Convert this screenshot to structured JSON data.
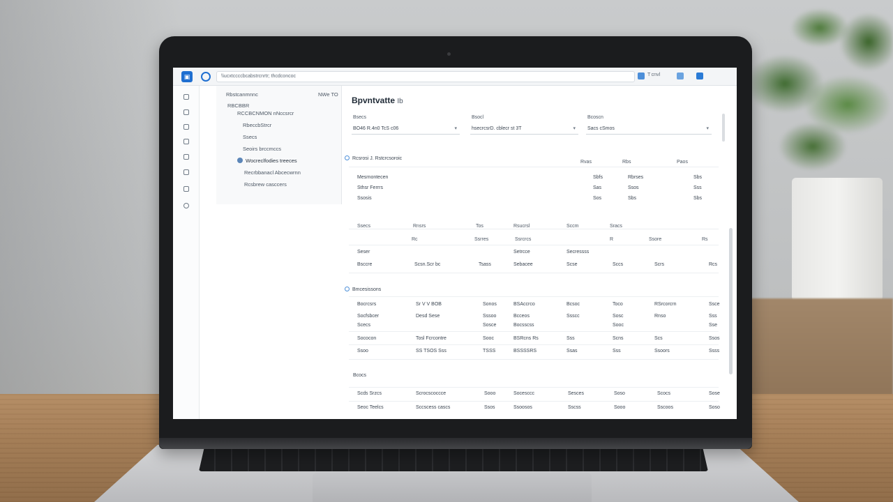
{
  "screen": {
    "address_text": "\\\\ucxtccccbcabstrcnrtr; thcdconcoc",
    "titlebar_right": [
      "T cnvl"
    ],
    "tree": {
      "header_left": "Rbstcanmnnc",
      "header_right": "NWe TO",
      "items": [
        {
          "label": "RBCBBR",
          "indent": 0
        },
        {
          "label": "RCCBCNMON nNccsrcr",
          "indent": 0
        },
        {
          "label": "RbeccbStrcr",
          "indent": 1
        },
        {
          "label": "Ssecs",
          "indent": 1
        },
        {
          "label": "Seoirs brccmccs",
          "indent": 1
        },
        {
          "label": "Wocreclfodies treeces",
          "indent": 1,
          "selected": true
        },
        {
          "label": "Recrbbanacl Abcecwrnn",
          "indent": 1
        },
        {
          "label": "Rcsbrew casccers",
          "indent": 1
        }
      ]
    },
    "content": {
      "page_title": "Bpvntvatte",
      "page_title_suffix": "Ib",
      "filters": [
        {
          "label": "Bsecs",
          "value": "BO46 R.4n0 TcS c06"
        },
        {
          "label": "Bsocl",
          "value": "hsecrcsrD. cblecr st 3T"
        },
        {
          "label": "Bcoscn",
          "value": "Sacs cSmos"
        }
      ],
      "table1": {
        "title": "Rcsrosi J. Rstcrcsoroic",
        "headers": [
          "",
          "Rvas",
          "Rbs",
          "Paos"
        ],
        "rows": [
          [
            "Mesrnontecen",
            "Sbfs",
            "Rbrses",
            "Sbs"
          ],
          [
            "Sthsr Ferrrs",
            "Sas",
            "Ssos",
            "Sss"
          ],
          [
            "Ssosis",
            "Sos",
            "Sbs",
            "Sbs"
          ]
        ]
      },
      "table2": {
        "headers": [
          "Ssecs",
          "Rnsrs",
          "Tos",
          "Rsucrsl",
          "Sccm",
          "Sracs"
        ],
        "subheaders": [
          "",
          "Rc",
          "Ssrres",
          "Ssrcrcs",
          "R  ",
          "Ssore",
          "Rs"
        ],
        "rows": [
          [
            "Seser",
            "",
            "",
            "Setrcce",
            "Secressss",
            "",
            "",
            ""
          ],
          [
            "Bsccre",
            "Scsn.Scr bc",
            "Tsass",
            "Sebacee",
            "Scse",
            "Sccs",
            "Scrs",
            "Rcs"
          ]
        ]
      },
      "table3": {
        "title": "Bmcesissons",
        "rows": [
          [
            "Bocrcsrs",
            "Sr V V BOB",
            "Sonos",
            "BSAccrco",
            "Bcsoc",
            "Toco",
            "RSrcorcrn",
            "Ssce"
          ],
          [
            "Socfsbcer",
            "Desd Sese",
            "Sssoo",
            "Bcceos",
            "Ssscc",
            "Sosc",
            "Rnso",
            "Sss"
          ],
          [
            "Scecs",
            "",
            "Sosce",
            "Bocsscss",
            "",
            "Sooc",
            "",
            "Sse"
          ],
          [
            "Sococon",
            "Tosl Fcrcontre",
            "Sooc",
            "BSRcns Rs",
            "Sss",
            "Scns",
            "Scs",
            "Ssos"
          ],
          [
            "Ssoo",
            "SS TSOS Sss",
            "TSSS",
            "BSSSSRS",
            "Ssas",
            "Sss",
            "Ssoors",
            "Ssss"
          ]
        ]
      },
      "table4": {
        "title": "Bcocs",
        "rows": [
          [
            "Scds Srzcs",
            "Scrocscoccce",
            "Sooo",
            "Socesccc",
            "Sesces",
            "Soso",
            "Scocs",
            "Sose"
          ],
          [
            "Seoc Teelcs",
            "Sccscess cascs",
            "Ssos",
            "Ssoosos",
            "Sscss",
            "Sooo",
            "Sscoos",
            "Soso"
          ]
        ]
      }
    }
  },
  "colors": {
    "accent": "#1f6fd1",
    "screen_bg": "#ffffff",
    "bezel": "#1b1c1e",
    "table_wood": "#a37c55",
    "plant": "#4d7a3a"
  }
}
